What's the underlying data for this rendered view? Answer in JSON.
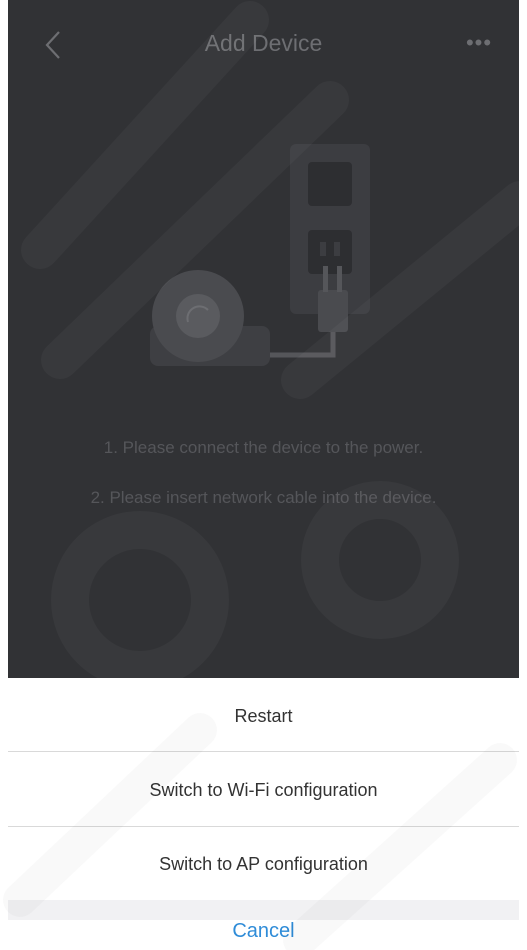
{
  "nav": {
    "title": "Add Device",
    "back_icon": "chevron-left-icon",
    "more_icon": "more-dots-icon",
    "more_glyph": "•••"
  },
  "illustration": {
    "name": "camera-and-power-outlet-illustration"
  },
  "instructions": {
    "step1": "1. Please connect the device to the power.",
    "step2": "2. Please insert network cable into the device."
  },
  "action_sheet": {
    "options": [
      {
        "label": "Restart"
      },
      {
        "label": "Switch to Wi-Fi configuration"
      },
      {
        "label": "Switch to AP configuration"
      }
    ],
    "cancel_label": "Cancel"
  },
  "colors": {
    "screen_bg": "#313235",
    "sheet_bg": "#ffffff",
    "cancel": "#2f8cd8",
    "option_text": "#333333"
  }
}
